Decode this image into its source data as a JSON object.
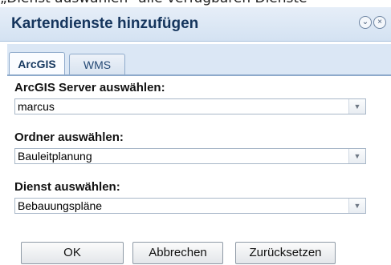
{
  "top_fragment": "„Dienst auswählen“ alle verfügbaren Dienste",
  "dialog": {
    "title": "Kartendienste hinzufügen",
    "icons": [
      "collapse-icon",
      "close-icon"
    ]
  },
  "tabs": [
    {
      "label": "ArcGIS",
      "active": true
    },
    {
      "label": "WMS",
      "active": false
    }
  ],
  "fields": {
    "server": {
      "label": "ArcGIS Server auswählen:",
      "value": "marcus"
    },
    "folder": {
      "label": "Ordner auswählen:",
      "value": "Bauleitplanung"
    },
    "service": {
      "label": "Dienst auswählen:",
      "value": "Bebauungspläne"
    }
  },
  "buttons": {
    "ok": "OK",
    "cancel": "Abbrechen",
    "reset": "Zurücksetzen"
  }
}
